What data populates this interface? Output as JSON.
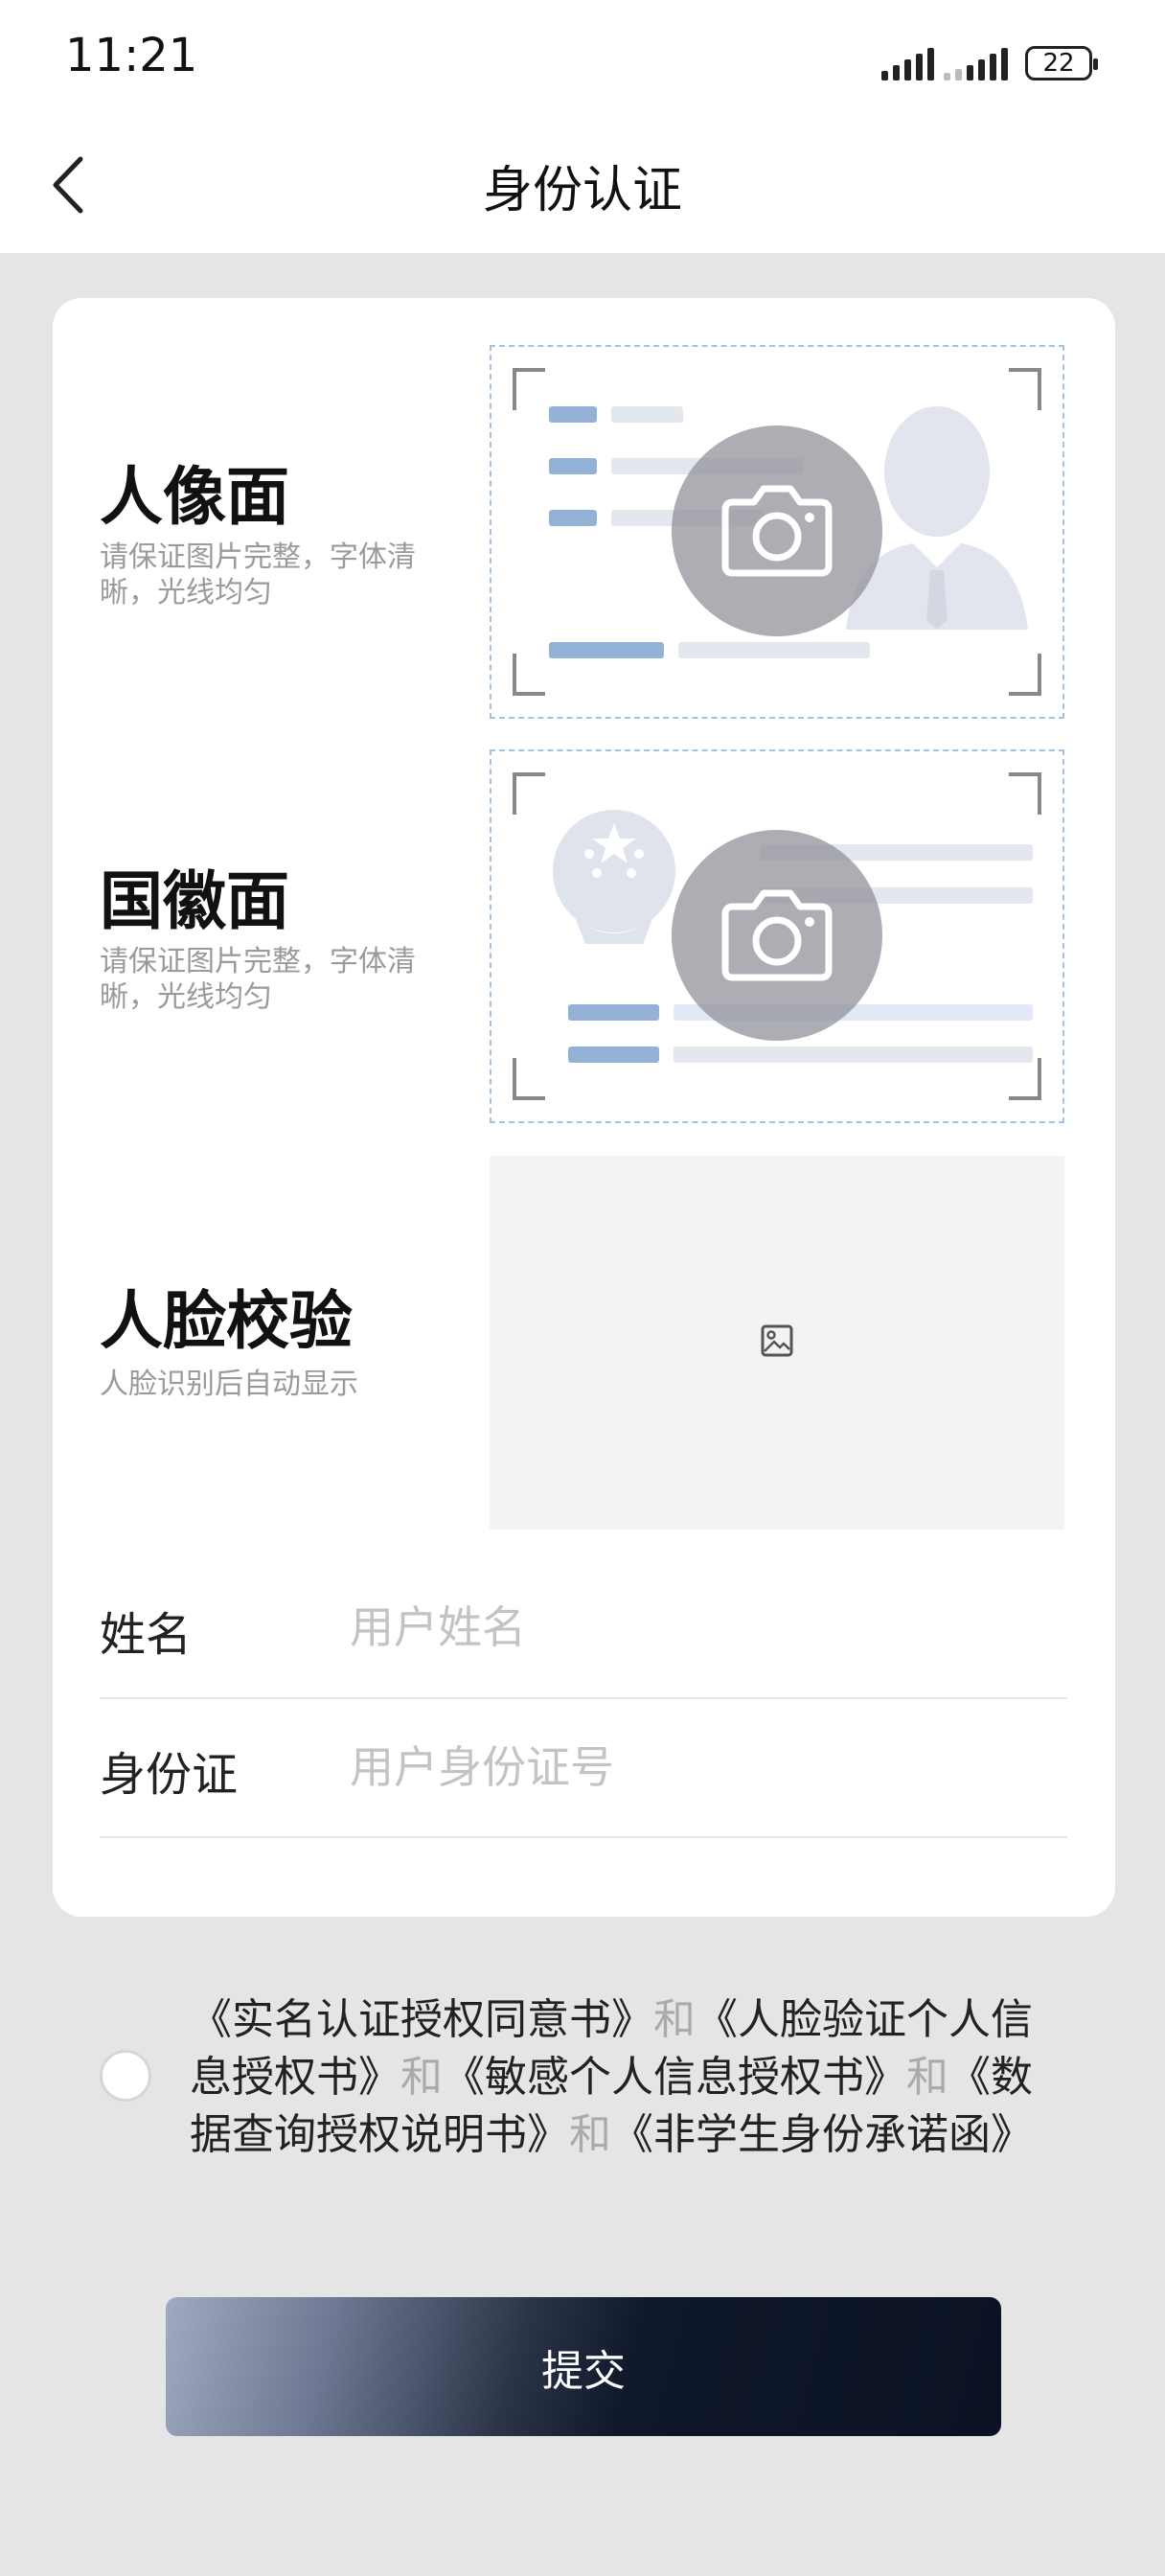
{
  "status_bar": {
    "time": "11:21",
    "battery": "22"
  },
  "nav": {
    "title": "身份认证"
  },
  "portrait_side": {
    "title": "人像面",
    "desc": "请保证图片完整，字体清晰，光线均匀"
  },
  "emblem_side": {
    "title": "国徽面",
    "desc": "请保证图片完整，字体清晰，光线均匀"
  },
  "face_check": {
    "title": "人脸校验",
    "desc": "人脸识别后自动显示"
  },
  "form": {
    "name_label": "姓名",
    "name_placeholder": "用户姓名",
    "id_label": "身份证",
    "id_placeholder": "用户身份证号"
  },
  "agreement": {
    "doc1": "《实名认证授权同意书》",
    "and1": "和",
    "doc2": "《人脸验证个人信息授权书》",
    "and2": "和",
    "doc3": "《敏感个人信息授权书》",
    "and3": "和",
    "doc4": "《数据查询授权说明书》",
    "and4": "和",
    "doc5": "《非学生身份承诺函》"
  },
  "submit_label": "提交",
  "colors": {
    "accent_dark": "#0f182a",
    "page_bg": "#e5e5e5",
    "card_bg": "#ffffff"
  },
  "icons": [
    "back-arrow-icon",
    "camera-icon",
    "image-placeholder-icon",
    "signal-icon",
    "battery-icon"
  ]
}
